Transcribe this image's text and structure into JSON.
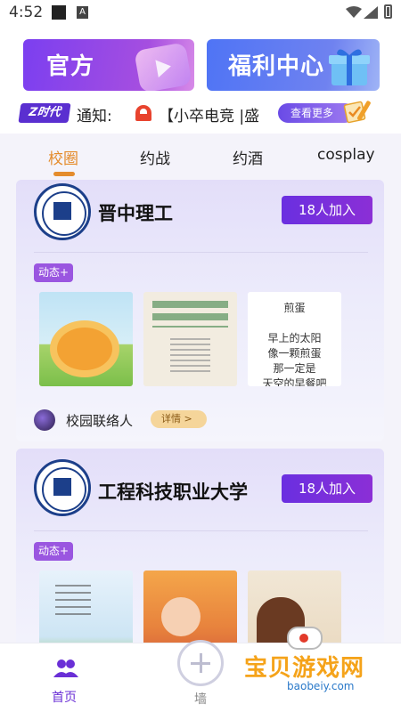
{
  "status_bar": {
    "time": "4:52"
  },
  "banners": [
    {
      "label": "官方",
      "icon": "video-play-icon"
    },
    {
      "label": "福利中心",
      "icon": "gift-icon"
    }
  ],
  "notice": {
    "brand": "Z时代",
    "label": "通知:",
    "text": "【小卒电竞 |盛",
    "more_label": "查看更多"
  },
  "tabs": [
    {
      "label": "校圈",
      "active": true
    },
    {
      "label": "约战",
      "active": false
    },
    {
      "label": "约酒",
      "active": false
    },
    {
      "label": "cosplay",
      "active": false
    }
  ],
  "schools": [
    {
      "name": "晋中理工",
      "join_label": "18人加入",
      "badge": "动态+",
      "thumb3_text": "煎蛋\n\n早上的太阳\n像一颗煎蛋\n那一定是\n天空的早餐吧",
      "contact_label": "校园联络人",
      "detail_label": "详情 >"
    },
    {
      "name": "工程科技职业大学",
      "join_label": "18人加入",
      "badge": "动态+"
    }
  ],
  "bottom_nav": {
    "home_label": "首页",
    "wall_label": "墙"
  },
  "watermark": {
    "text": "宝贝游戏网",
    "url": "baobeiy.com"
  },
  "colors": {
    "accent": "#6a2fd6",
    "tab_active": "#e48c2c",
    "join_button": "#7a2fdc"
  }
}
